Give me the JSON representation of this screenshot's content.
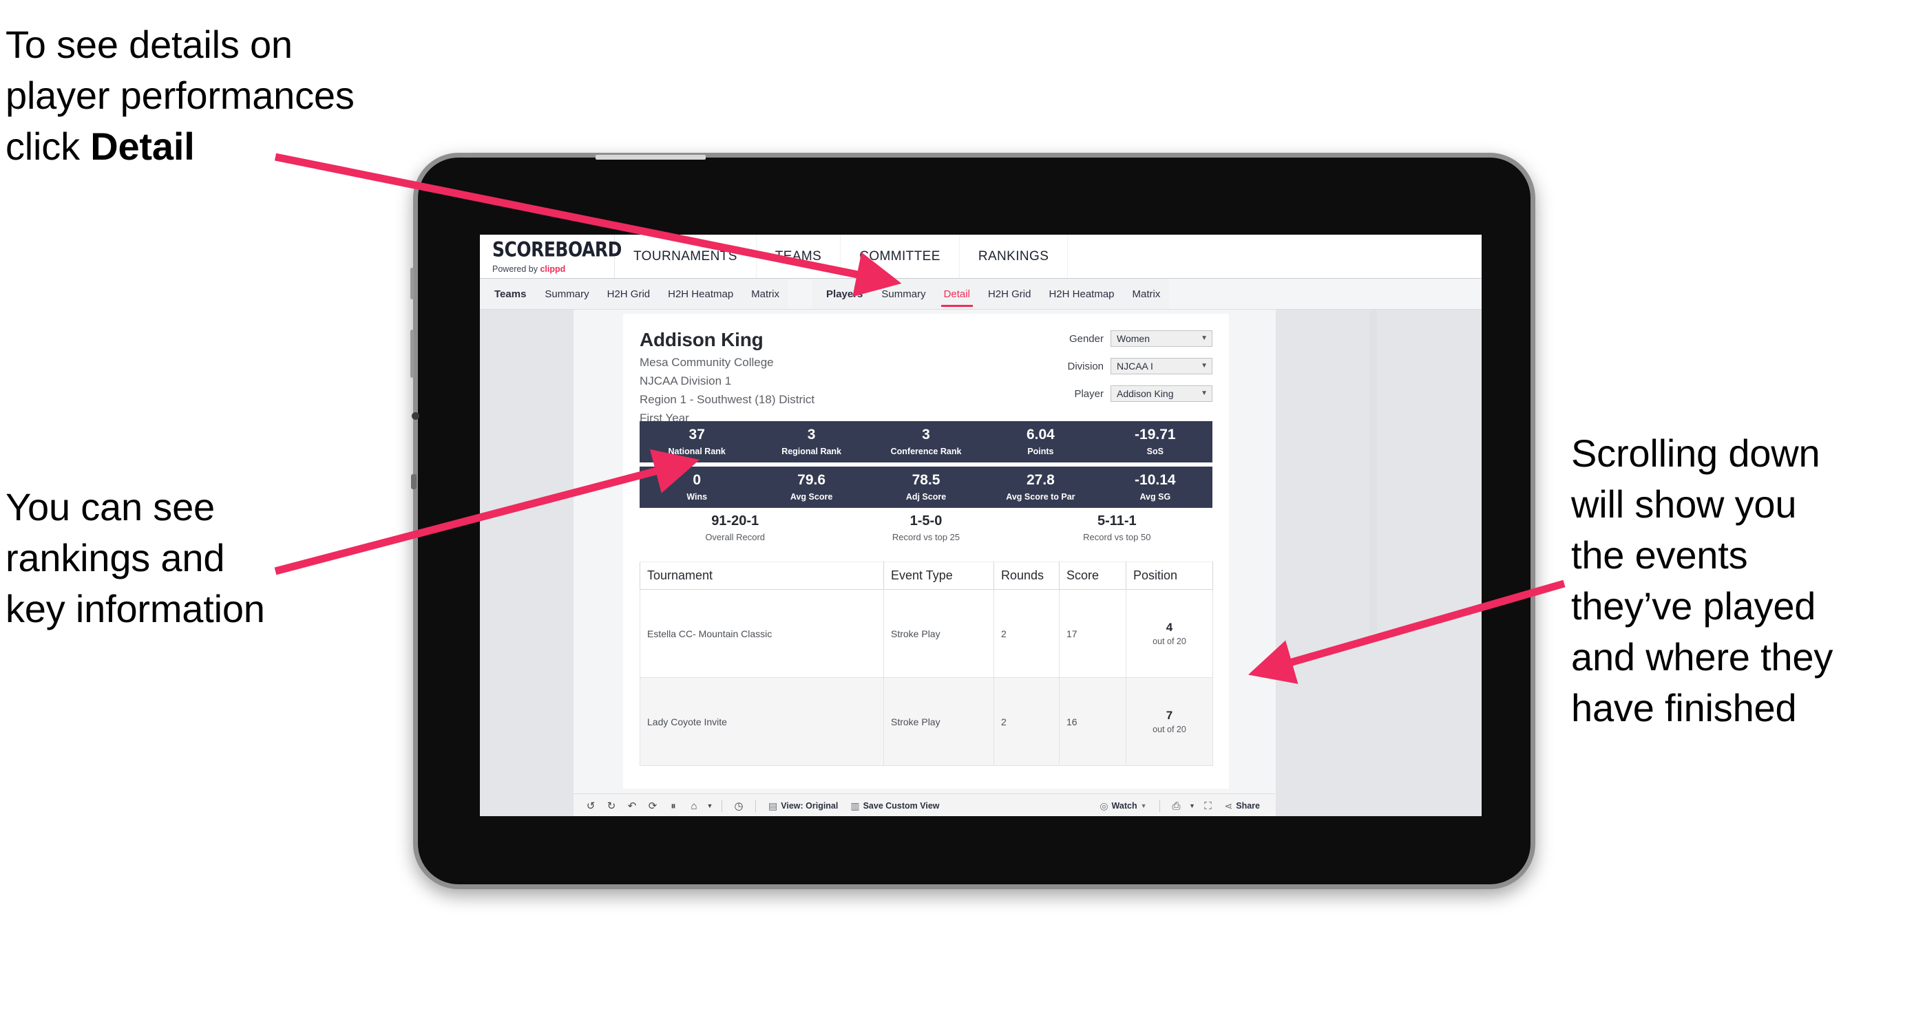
{
  "annotations": {
    "detail": {
      "text_before": "To see details on\nplayer performances\nclick ",
      "bold": "Detail"
    },
    "rankings": {
      "text": "You can see\nrankings and\nkey information"
    },
    "scrolling": {
      "text": "Scrolling down\nwill show you\nthe events\nthey’ve played\nand where they\nhave finished"
    }
  },
  "colors": {
    "accent": "#ef2d56",
    "band": "#353b52",
    "arrow": "#ee2a5f"
  },
  "app": {
    "logo": {
      "word": "SCOREBOARD",
      "powered_prefix": "Powered by ",
      "brand": "clippd"
    },
    "topnav": [
      "TOURNAMENTS",
      "TEAMS",
      "COMMITTEE",
      "RANKINGS"
    ],
    "tabgroups": [
      {
        "label": "Teams",
        "tabs": [
          "Summary",
          "H2H Grid",
          "H2H Heatmap",
          "Matrix"
        ],
        "active": -1
      },
      {
        "label": "Players",
        "tabs": [
          "Summary",
          "Detail",
          "H2H Grid",
          "H2H Heatmap",
          "Matrix"
        ],
        "active": 1
      }
    ]
  },
  "player": {
    "name": "Addison King",
    "meta": [
      "Mesa Community College",
      "NJCAA Division 1",
      "Region 1 - Southwest (18) District",
      "First Year"
    ]
  },
  "filters": [
    {
      "label": "Gender",
      "value": "Women"
    },
    {
      "label": "Division",
      "value": "NJCAA I"
    },
    {
      "label": "Player",
      "value": "Addison King"
    }
  ],
  "stat_bands": [
    [
      {
        "value": "37",
        "label": "National Rank"
      },
      {
        "value": "3",
        "label": "Regional Rank"
      },
      {
        "value": "3",
        "label": "Conference Rank"
      },
      {
        "value": "6.04",
        "label": "Points"
      },
      {
        "value": "-19.71",
        "label": "SoS"
      }
    ],
    [
      {
        "value": "0",
        "label": "Wins"
      },
      {
        "value": "79.6",
        "label": "Avg Score"
      },
      {
        "value": "78.5",
        "label": "Adj Score"
      },
      {
        "value": "27.8",
        "label": "Avg Score to Par"
      },
      {
        "value": "-10.14",
        "label": "Avg SG"
      }
    ]
  ],
  "records": [
    {
      "value": "91-20-1",
      "label": "Overall Record"
    },
    {
      "value": "1-5-0",
      "label": "Record vs top 25"
    },
    {
      "value": "5-11-1",
      "label": "Record vs top 50"
    }
  ],
  "table": {
    "headers": [
      "Tournament",
      "Event Type",
      "Rounds",
      "Score",
      "Position"
    ],
    "rows": [
      {
        "tournament": "Estella CC- Mountain Classic",
        "event_type": "Stroke Play",
        "rounds": "2",
        "score": "17",
        "position": "4",
        "position_of": "out of 20"
      },
      {
        "tournament": "Lady Coyote Invite",
        "event_type": "Stroke Play",
        "rounds": "2",
        "score": "16",
        "position": "7",
        "position_of": "out of 20"
      }
    ]
  },
  "toolbar": {
    "view_label": "View: Original",
    "save_label": "Save Custom View",
    "watch_label": "Watch",
    "share_label": "Share"
  }
}
